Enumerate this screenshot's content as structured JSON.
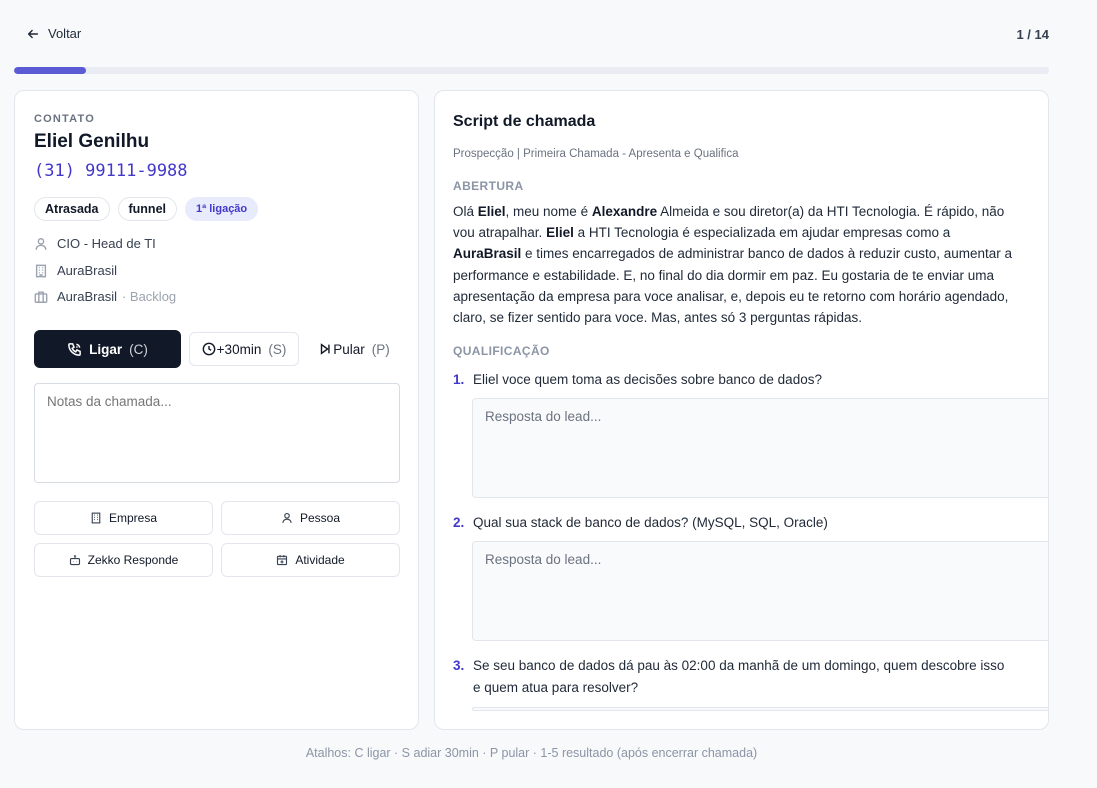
{
  "header": {
    "back_label": "Voltar",
    "counter": "1 / 14",
    "progress_fraction": 0.07
  },
  "contact": {
    "section_label": "CONTATO",
    "name": "Eliel Genilhu",
    "phone": "(31) 99111-9988",
    "tags": [
      "Atrasada",
      "funnel",
      "1ª ligação"
    ],
    "role": "CIO - Head de TI",
    "company": "AuraBrasil",
    "account": "AuraBrasil",
    "account_status": "· Backlog"
  },
  "actions": {
    "call_label": "Ligar",
    "call_key": "(C)",
    "snooze_label": "+30min",
    "snooze_key": "(S)",
    "skip_label": "Pular",
    "skip_key": "(P)"
  },
  "notes": {
    "placeholder": "Notas da chamada..."
  },
  "shortcuts": {
    "company": "Empresa",
    "person": "Pessoa",
    "zekko": "Zekko Responde",
    "activity": "Atividade"
  },
  "script": {
    "title": "Script de chamada",
    "subtitle": "Prospecção | Primeira Chamada - Apresenta e Qualifica",
    "opening_heading": "ABERTURA",
    "opening_parts": {
      "p1": "Olá ",
      "b1": "Eliel",
      "p2": ", meu nome é ",
      "b2": "Alexandre",
      "p3": " Almeida e sou diretor(a) da HTI Tecnologia. É rápido, não vou atrapalhar. ",
      "b3": "Eliel",
      "p4": " a HTI Tecnologia é especializada em ajudar empresas como a ",
      "b4": "AuraBrasil",
      "p5": " e times encarregados de administrar banco de dados à reduzir custo, aumentar a performance e estabilidade. E, no final do dia dormir em paz. Eu gostaria de te enviar uma apresentação da empresa para voce analisar, e, depois eu te retorno com horário agendado, claro, se fizer sentido para voce. Mas, antes só 3 perguntas rápidas."
    },
    "qualification_heading": "QUALIFICAÇÃO",
    "answer_placeholder": "Resposta do lead...",
    "questions": [
      {
        "num": "1.",
        "text": "Eliel voce quem toma as decisões sobre banco de dados?"
      },
      {
        "num": "2.",
        "text": "Qual sua stack de banco de dados? (MySQL, SQL, Oracle)"
      },
      {
        "num": "3.",
        "text": "Se seu banco de dados dá pau às 02:00 da manhã de um domingo, quem descobre isso e quem atua para resolver?"
      }
    ]
  },
  "footer": {
    "hint": "Atalhos: C ligar · S adiar 30min · P pular · 1-5 resultado (após encerrar chamada)"
  },
  "colors": {
    "accent": "#4338ca",
    "progress": "#5b5bd6",
    "primary_button": "#111827"
  }
}
